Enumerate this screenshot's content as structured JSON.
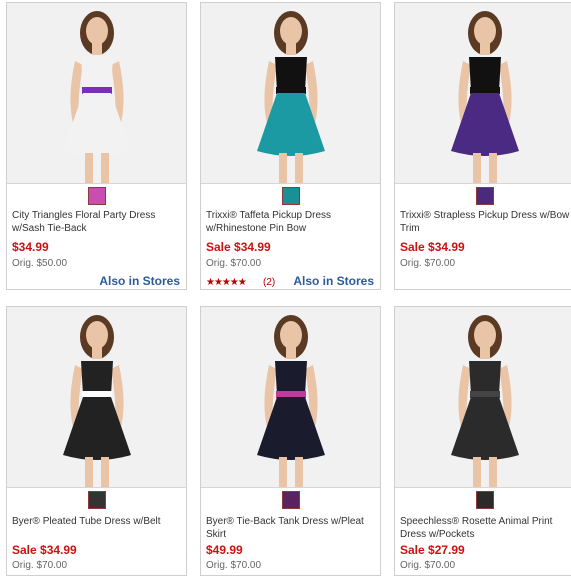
{
  "products": [
    {
      "name": "City Triangles Floral Party Dress w/Sash Tie-Back",
      "price": "$34.99",
      "orig": "Orig. $50.00",
      "stores": "Also in Stores",
      "swatch_color": "#c84fb0",
      "dress_color": "#f2f2f2",
      "accent": "#7b2fb6"
    },
    {
      "name": "Trixxi® Taffeta Pickup Dress w/Rhinestone Pin Bow",
      "price": "Sale $34.99",
      "orig": "Orig. $70.00",
      "stores": "Also in Stores",
      "stars": "★★★★★",
      "reviews": "(2)",
      "rating": 5,
      "swatch_color": "#1a8f96",
      "dress_color": "#1c9aa3",
      "accent": "#111111"
    },
    {
      "name": "Trixxi® Strapless Pickup Dress w/Bow Trim",
      "price": "Sale $34.99",
      "orig": "Orig. $70.00",
      "swatch_color": "#4b2a7e",
      "dress_color": "#4a2a82",
      "accent": "#111111"
    },
    {
      "name": "Byer® Pleated Tube Dress w/Belt",
      "price": "Sale $34.99",
      "orig": "Orig. $70.00",
      "swatch_color": "#333333",
      "dress_color": "#222222",
      "accent": "#ffffff"
    },
    {
      "name": "Byer® Tie-Back Tank Dress w/Pleat Skirt",
      "price": "$49.99",
      "orig": "Orig. $70.00",
      "swatch_color": "#5a2260",
      "dress_color": "#1b1b2e",
      "accent": "#c03a9a"
    },
    {
      "name": "Speechless® Rosette Animal Print Dress w/Pockets",
      "price": "Sale $27.99",
      "orig": "Orig. $70.00",
      "swatch_color": "#2a2a2a",
      "dress_color": "#2b2b2b",
      "accent": "#444444"
    }
  ]
}
